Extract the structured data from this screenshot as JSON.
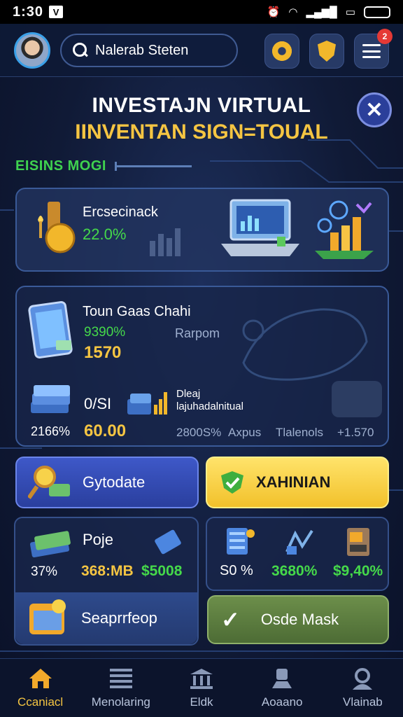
{
  "status_bar": {
    "time": "1:30",
    "badge": "V"
  },
  "header": {
    "search_value": "Nalerab Steten",
    "notification_count": "2"
  },
  "title": {
    "line1": "INVESTAJN VIRTUAL",
    "line2": "IINVENTAN SIGN=TOUAL"
  },
  "section": {
    "label": "EISINS MOGI"
  },
  "card1": {
    "name": "Ercsecinack",
    "percent": "22.0%"
  },
  "card2": {
    "name": "Toun Gaas Chahi",
    "stat1": "9390%",
    "stat2": "1570",
    "tag": "Rarpom",
    "row_label": "0/SI",
    "desc_line1": "Dleaj",
    "desc_line2": "lajuhadalnitual",
    "pct_left": "2166%",
    "value": "60.00",
    "mid_a": "2800S%",
    "mid_b": "Axpus",
    "mid_c": "Tlalenols",
    "right_value": "+1.570"
  },
  "buttons": {
    "blue": "Gytodate",
    "yellow": "XAHINIAN",
    "green": "Osde Mask"
  },
  "panel_left": {
    "title": "Poje",
    "v1": "37%",
    "v2": "368:MB",
    "v3": "$5008",
    "bottom_label": "Seaprrfeop"
  },
  "panel_right": {
    "v1": "S0 %",
    "v2": "3680%",
    "v3": "$9,40%"
  },
  "nav": [
    {
      "label": "Ccaniacl"
    },
    {
      "label": "Menolaring"
    },
    {
      "label": "Eldk"
    },
    {
      "label": "Aoaano"
    },
    {
      "label": "Vlainab"
    }
  ],
  "colors": {
    "accent_green": "#45d94a",
    "accent_gold": "#f5c542",
    "accent_blue": "#3e58c8"
  }
}
